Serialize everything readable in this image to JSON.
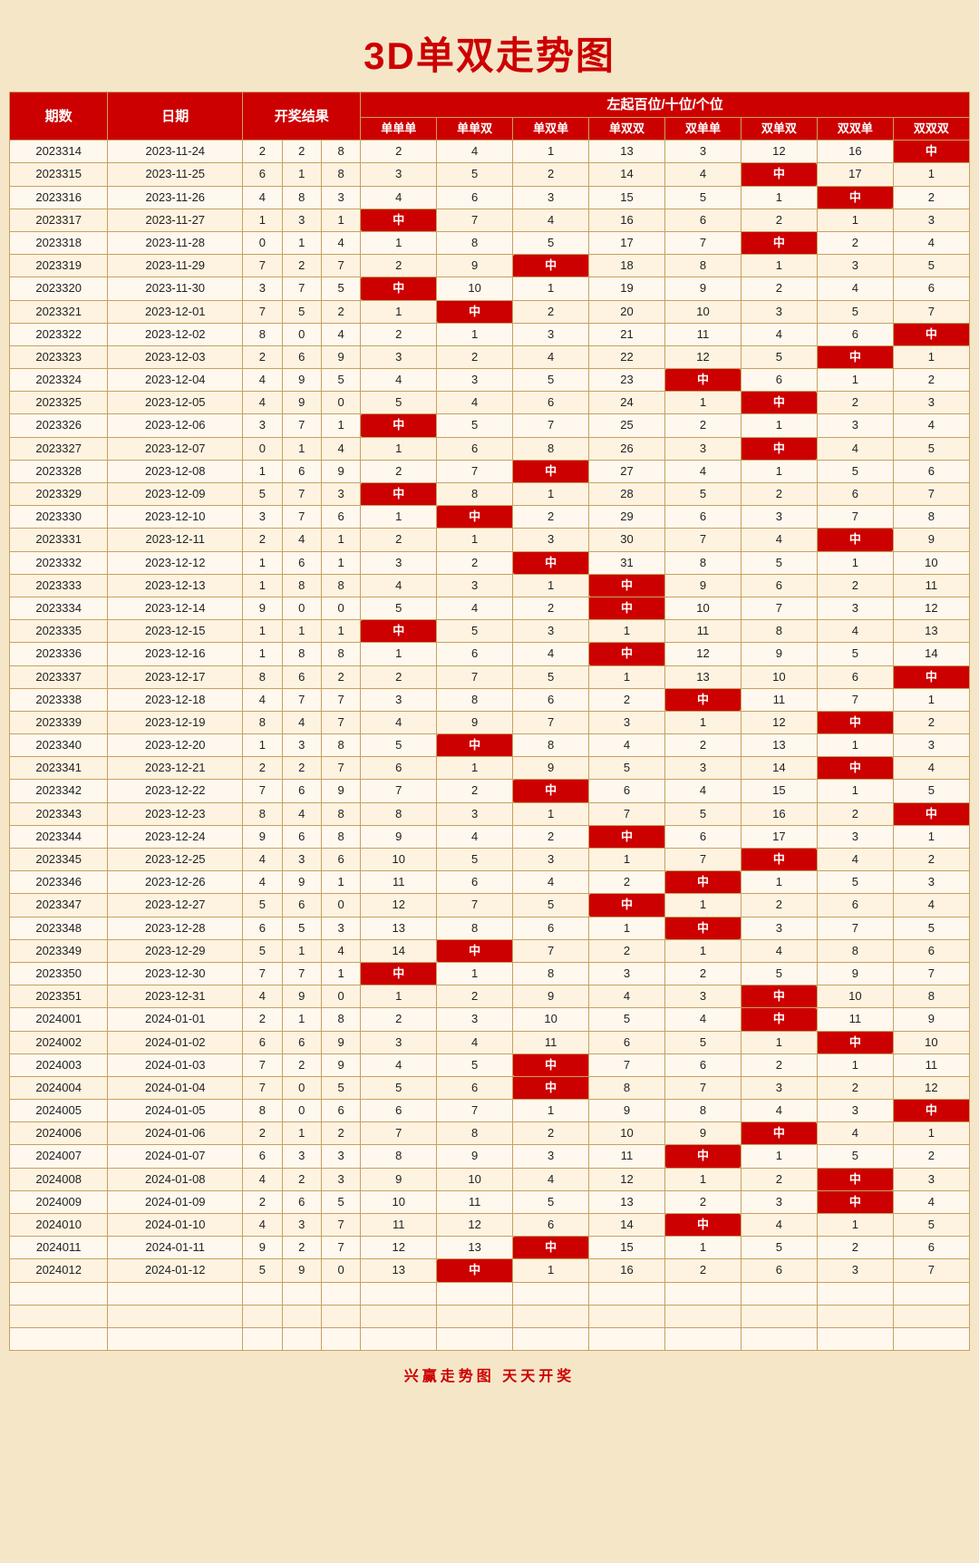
{
  "title": "3D单双走势图",
  "subtitle": "左起百位/十位/个位",
  "headers": {
    "qishu": "期数",
    "date": "日期",
    "result": "开奖结果",
    "cols": [
      "单单单",
      "单单双",
      "单双单",
      "单双双",
      "双单单",
      "双单双",
      "双双单",
      "双双双"
    ]
  },
  "footer": "兴赢走势图    天天开奖",
  "zhong": "中",
  "rows": [
    {
      "id": "2023314",
      "date": "2023-11-24",
      "d": [
        2,
        2,
        8
      ],
      "c": [
        2,
        4,
        1,
        13,
        3,
        12,
        16,
        "中"
      ]
    },
    {
      "id": "2023315",
      "date": "2023-11-25",
      "d": [
        6,
        1,
        8
      ],
      "c": [
        3,
        5,
        2,
        14,
        4,
        "中",
        17,
        1
      ]
    },
    {
      "id": "2023316",
      "date": "2023-11-26",
      "d": [
        4,
        8,
        3
      ],
      "c": [
        4,
        6,
        3,
        15,
        5,
        1,
        "中",
        2
      ]
    },
    {
      "id": "2023317",
      "date": "2023-11-27",
      "d": [
        1,
        3,
        1
      ],
      "c": [
        "中",
        7,
        4,
        16,
        6,
        2,
        1,
        3
      ]
    },
    {
      "id": "2023318",
      "date": "2023-11-28",
      "d": [
        0,
        1,
        4
      ],
      "c": [
        1,
        8,
        5,
        17,
        7,
        "中",
        2,
        4
      ]
    },
    {
      "id": "2023319",
      "date": "2023-11-29",
      "d": [
        7,
        2,
        7
      ],
      "c": [
        2,
        9,
        "中",
        18,
        8,
        1,
        3,
        5
      ]
    },
    {
      "id": "2023320",
      "date": "2023-11-30",
      "d": [
        3,
        7,
        5
      ],
      "c": [
        "中",
        10,
        1,
        19,
        9,
        2,
        4,
        6
      ]
    },
    {
      "id": "2023321",
      "date": "2023-12-01",
      "d": [
        7,
        5,
        2
      ],
      "c": [
        1,
        "中",
        2,
        20,
        10,
        3,
        5,
        7
      ]
    },
    {
      "id": "2023322",
      "date": "2023-12-02",
      "d": [
        8,
        0,
        4
      ],
      "c": [
        2,
        1,
        3,
        21,
        11,
        4,
        6,
        "中"
      ]
    },
    {
      "id": "2023323",
      "date": "2023-12-03",
      "d": [
        2,
        6,
        9
      ],
      "c": [
        3,
        2,
        4,
        22,
        12,
        5,
        "中",
        1
      ]
    },
    {
      "id": "2023324",
      "date": "2023-12-04",
      "d": [
        4,
        9,
        5
      ],
      "c": [
        4,
        3,
        5,
        23,
        "中",
        6,
        1,
        2
      ]
    },
    {
      "id": "2023325",
      "date": "2023-12-05",
      "d": [
        4,
        9,
        0
      ],
      "c": [
        5,
        4,
        6,
        24,
        1,
        "中",
        2,
        3
      ]
    },
    {
      "id": "2023326",
      "date": "2023-12-06",
      "d": [
        3,
        7,
        1
      ],
      "c": [
        "中",
        5,
        7,
        25,
        2,
        1,
        3,
        4
      ]
    },
    {
      "id": "2023327",
      "date": "2023-12-07",
      "d": [
        0,
        1,
        4
      ],
      "c": [
        1,
        6,
        8,
        26,
        3,
        "中",
        4,
        5
      ]
    },
    {
      "id": "2023328",
      "date": "2023-12-08",
      "d": [
        1,
        6,
        9
      ],
      "c": [
        2,
        7,
        "中",
        27,
        4,
        1,
        5,
        6
      ]
    },
    {
      "id": "2023329",
      "date": "2023-12-09",
      "d": [
        5,
        7,
        3
      ],
      "c": [
        "中",
        8,
        1,
        28,
        5,
        2,
        6,
        7
      ]
    },
    {
      "id": "2023330",
      "date": "2023-12-10",
      "d": [
        3,
        7,
        6
      ],
      "c": [
        1,
        "中",
        2,
        29,
        6,
        3,
        7,
        8
      ]
    },
    {
      "id": "2023331",
      "date": "2023-12-11",
      "d": [
        2,
        4,
        1
      ],
      "c": [
        2,
        1,
        3,
        30,
        7,
        4,
        "中",
        9
      ]
    },
    {
      "id": "2023332",
      "date": "2023-12-12",
      "d": [
        1,
        6,
        1
      ],
      "c": [
        3,
        2,
        "中",
        31,
        8,
        5,
        1,
        10
      ]
    },
    {
      "id": "2023333",
      "date": "2023-12-13",
      "d": [
        1,
        8,
        8
      ],
      "c": [
        4,
        3,
        1,
        "中",
        9,
        6,
        2,
        11
      ]
    },
    {
      "id": "2023334",
      "date": "2023-12-14",
      "d": [
        9,
        0,
        0
      ],
      "c": [
        5,
        4,
        2,
        "中",
        10,
        7,
        3,
        12
      ]
    },
    {
      "id": "2023335",
      "date": "2023-12-15",
      "d": [
        1,
        1,
        1
      ],
      "c": [
        "中",
        5,
        3,
        1,
        11,
        8,
        4,
        13
      ]
    },
    {
      "id": "2023336",
      "date": "2023-12-16",
      "d": [
        1,
        8,
        8
      ],
      "c": [
        1,
        6,
        4,
        "中",
        12,
        9,
        5,
        14
      ]
    },
    {
      "id": "2023337",
      "date": "2023-12-17",
      "d": [
        8,
        6,
        2
      ],
      "c": [
        2,
        7,
        5,
        1,
        13,
        10,
        6,
        "中"
      ]
    },
    {
      "id": "2023338",
      "date": "2023-12-18",
      "d": [
        4,
        7,
        7
      ],
      "c": [
        3,
        8,
        6,
        2,
        "中",
        11,
        7,
        1
      ]
    },
    {
      "id": "2023339",
      "date": "2023-12-19",
      "d": [
        8,
        4,
        7
      ],
      "c": [
        4,
        9,
        7,
        3,
        1,
        12,
        "中",
        2
      ]
    },
    {
      "id": "2023340",
      "date": "2023-12-20",
      "d": [
        1,
        3,
        8
      ],
      "c": [
        5,
        "中",
        8,
        4,
        2,
        13,
        1,
        3
      ]
    },
    {
      "id": "2023341",
      "date": "2023-12-21",
      "d": [
        2,
        2,
        7
      ],
      "c": [
        6,
        1,
        9,
        5,
        3,
        14,
        "中",
        4
      ]
    },
    {
      "id": "2023342",
      "date": "2023-12-22",
      "d": [
        7,
        6,
        9
      ],
      "c": [
        7,
        2,
        "中",
        6,
        4,
        15,
        1,
        5
      ]
    },
    {
      "id": "2023343",
      "date": "2023-12-23",
      "d": [
        8,
        4,
        8
      ],
      "c": [
        8,
        3,
        1,
        7,
        5,
        16,
        2,
        "中"
      ]
    },
    {
      "id": "2023344",
      "date": "2023-12-24",
      "d": [
        9,
        6,
        8
      ],
      "c": [
        9,
        4,
        2,
        "中",
        6,
        17,
        3,
        1
      ]
    },
    {
      "id": "2023345",
      "date": "2023-12-25",
      "d": [
        4,
        3,
        6
      ],
      "c": [
        10,
        5,
        3,
        1,
        7,
        "中",
        4,
        2
      ]
    },
    {
      "id": "2023346",
      "date": "2023-12-26",
      "d": [
        4,
        9,
        1
      ],
      "c": [
        11,
        6,
        4,
        2,
        "中",
        1,
        5,
        3
      ]
    },
    {
      "id": "2023347",
      "date": "2023-12-27",
      "d": [
        5,
        6,
        0
      ],
      "c": [
        12,
        7,
        5,
        "中",
        1,
        2,
        6,
        4
      ]
    },
    {
      "id": "2023348",
      "date": "2023-12-28",
      "d": [
        6,
        5,
        3
      ],
      "c": [
        13,
        8,
        6,
        1,
        "中",
        3,
        7,
        5
      ]
    },
    {
      "id": "2023349",
      "date": "2023-12-29",
      "d": [
        5,
        1,
        4
      ],
      "c": [
        14,
        "中",
        7,
        2,
        1,
        4,
        8,
        6
      ]
    },
    {
      "id": "2023350",
      "date": "2023-12-30",
      "d": [
        7,
        7,
        1
      ],
      "c": [
        "中",
        1,
        8,
        3,
        2,
        5,
        9,
        7
      ]
    },
    {
      "id": "2023351",
      "date": "2023-12-31",
      "d": [
        4,
        9,
        0
      ],
      "c": [
        1,
        2,
        9,
        4,
        3,
        "中",
        10,
        8
      ]
    },
    {
      "id": "2024001",
      "date": "2024-01-01",
      "d": [
        2,
        1,
        8
      ],
      "c": [
        2,
        3,
        10,
        5,
        4,
        "中",
        11,
        9
      ]
    },
    {
      "id": "2024002",
      "date": "2024-01-02",
      "d": [
        6,
        6,
        9
      ],
      "c": [
        3,
        4,
        11,
        6,
        5,
        1,
        "中",
        10
      ]
    },
    {
      "id": "2024003",
      "date": "2024-01-03",
      "d": [
        7,
        2,
        9
      ],
      "c": [
        4,
        5,
        "中",
        7,
        6,
        2,
        1,
        11
      ]
    },
    {
      "id": "2024004",
      "date": "2024-01-04",
      "d": [
        7,
        0,
        5
      ],
      "c": [
        5,
        6,
        "中",
        8,
        7,
        3,
        2,
        12
      ]
    },
    {
      "id": "2024005",
      "date": "2024-01-05",
      "d": [
        8,
        0,
        6
      ],
      "c": [
        6,
        7,
        1,
        9,
        8,
        4,
        3,
        "中"
      ]
    },
    {
      "id": "2024006",
      "date": "2024-01-06",
      "d": [
        2,
        1,
        2
      ],
      "c": [
        7,
        8,
        2,
        10,
        9,
        "中",
        4,
        1
      ]
    },
    {
      "id": "2024007",
      "date": "2024-01-07",
      "d": [
        6,
        3,
        3
      ],
      "c": [
        8,
        9,
        3,
        11,
        "中",
        1,
        5,
        2
      ]
    },
    {
      "id": "2024008",
      "date": "2024-01-08",
      "d": [
        4,
        2,
        3
      ],
      "c": [
        9,
        10,
        4,
        12,
        1,
        2,
        "中",
        3
      ]
    },
    {
      "id": "2024009",
      "date": "2024-01-09",
      "d": [
        2,
        6,
        5
      ],
      "c": [
        10,
        11,
        5,
        13,
        2,
        3,
        "中",
        4
      ]
    },
    {
      "id": "2024010",
      "date": "2024-01-10",
      "d": [
        4,
        3,
        7
      ],
      "c": [
        11,
        12,
        6,
        14,
        "中",
        4,
        1,
        5
      ]
    },
    {
      "id": "2024011",
      "date": "2024-01-11",
      "d": [
        9,
        2,
        7
      ],
      "c": [
        12,
        13,
        "中",
        15,
        1,
        5,
        2,
        6
      ]
    },
    {
      "id": "2024012",
      "date": "2024-01-12",
      "d": [
        5,
        9,
        0
      ],
      "c": [
        13,
        "中",
        1,
        16,
        2,
        6,
        3,
        7
      ]
    }
  ]
}
